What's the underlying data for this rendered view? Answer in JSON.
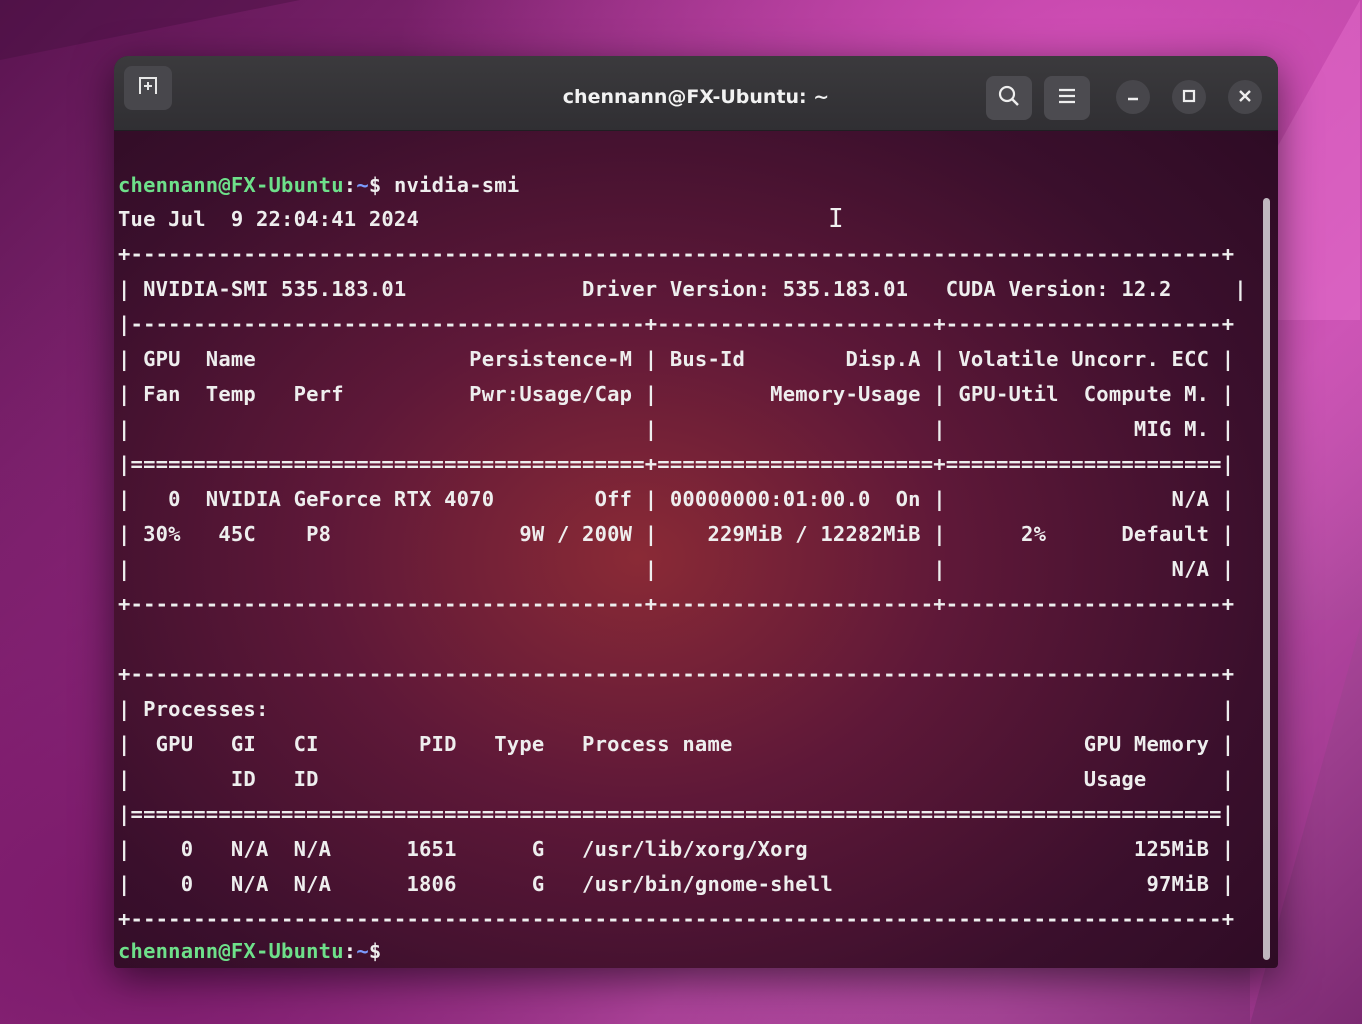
{
  "window": {
    "title": "chennann@FX-Ubuntu: ~",
    "buttons": {
      "new_tab_icon": "new-tab-icon",
      "search_icon": "search-icon",
      "menu_icon": "hamburger-menu-icon",
      "minimize_icon": "minimize-icon",
      "maximize_icon": "maximize-icon",
      "close_icon": "close-icon"
    }
  },
  "terminal": {
    "prompt_user_host": "chennann@FX-Ubuntu",
    "prompt_sep": ":",
    "prompt_path": "~",
    "prompt_symbol": "$",
    "command": " nvidia-smi",
    "lines": [
      "Tue Jul  9 22:04:41 2024",
      "+---------------------------------------------------------------------------------------+",
      "| NVIDIA-SMI 535.183.01              Driver Version: 535.183.01   CUDA Version: 12.2     |",
      "|-----------------------------------------+----------------------+----------------------+",
      "| GPU  Name                 Persistence-M | Bus-Id        Disp.A | Volatile Uncorr. ECC |",
      "| Fan  Temp   Perf          Pwr:Usage/Cap |         Memory-Usage | GPU-Util  Compute M. |",
      "|                                         |                      |               MIG M. |",
      "|=========================================+======================+======================|",
      "|   0  NVIDIA GeForce RTX 4070        Off | 00000000:01:00.0  On |                  N/A |",
      "| 30%   45C    P8               9W / 200W |    229MiB / 12282MiB |      2%      Default |",
      "|                                         |                      |                  N/A |",
      "+-----------------------------------------+----------------------+----------------------+",
      "",
      "+---------------------------------------------------------------------------------------+",
      "| Processes:                                                                            |",
      "|  GPU   GI   CI        PID   Type   Process name                            GPU Memory |",
      "|        ID   ID                                                             Usage      |",
      "|=======================================================================================|",
      "|    0   N/A  N/A      1651      G   /usr/lib/xorg/Xorg                          125MiB |",
      "|    0   N/A  N/A      1806      G   /usr/bin/gnome-shell                         97MiB |",
      "+---------------------------------------------------------------------------------------+"
    ]
  },
  "colors": {
    "prompt_user": "#6ee08a",
    "prompt_path": "#7c9cff",
    "text": "#eeeeee"
  }
}
